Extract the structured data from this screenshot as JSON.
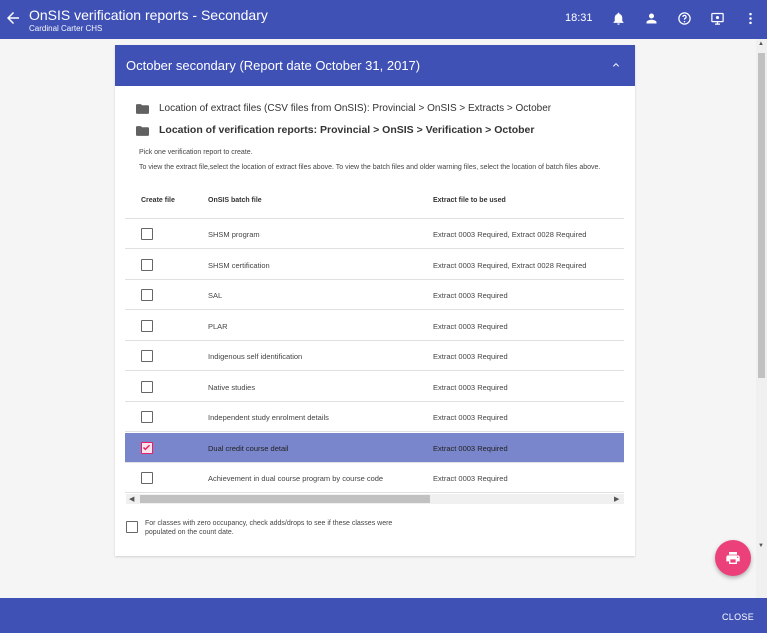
{
  "app": {
    "title": "OnSIS verification reports - Secondary",
    "subtitle": "Cardinal Carter CHS",
    "time": "18:31"
  },
  "icons": {
    "back": "arrow-left-icon",
    "notifications": "bell-icon",
    "account": "person-icon",
    "help": "help-circle-icon",
    "screen": "monitor-settings-icon",
    "more": "more-vert-icon",
    "folder": "folder-icon",
    "collapse": "chevron-up-icon",
    "print": "print-icon"
  },
  "card": {
    "title": "October secondary (Report date October 31, 2017)",
    "extract_location": "Location of extract files (CSV files from OnSIS):   Provincial > OnSIS > Extracts > October",
    "verification_location": "Location of verification reports: Provincial > OnSIS > Verification > October",
    "pick_note": "Pick one verification report to create.",
    "view_note": "To view the extract file,select the location of extract files above. To view the batch files and older warning files, select the location of batch files above."
  },
  "table": {
    "headers": [
      "Create file",
      "OnSIS batch file",
      "Extract file to be used"
    ],
    "rows": [
      {
        "name": "SHSM program",
        "extract": "Extract 0003 Required, Extract 0028 Required",
        "checked": false
      },
      {
        "name": "SHSM certification",
        "extract": "Extract 0003 Required, Extract 0028 Required",
        "checked": false
      },
      {
        "name": "SAL",
        "extract": "Extract 0003 Required",
        "checked": false
      },
      {
        "name": "PLAR",
        "extract": "Extract 0003 Required",
        "checked": false
      },
      {
        "name": "Indigenous self identification",
        "extract": "Extract 0003 Required",
        "checked": false
      },
      {
        "name": "Native studies",
        "extract": "Extract 0003 Required",
        "checked": false
      },
      {
        "name": "Independent study enrolment details",
        "extract": "Extract 0003 Required",
        "checked": false
      },
      {
        "name": "Dual credit course detail",
        "extract": "Extract 0003 Required",
        "checked": true
      },
      {
        "name": "Achievement in dual course program by course code",
        "extract": "Extract 0003 Required",
        "checked": false
      }
    ]
  },
  "footnote": "For classes with zero occupancy, check adds/drops to see if these classes were populated on the count date.",
  "actions": {
    "close": "CLOSE"
  },
  "colors": {
    "primary": "#3f51b5",
    "selected_row": "#7986cb",
    "accent": "#ec407a"
  }
}
